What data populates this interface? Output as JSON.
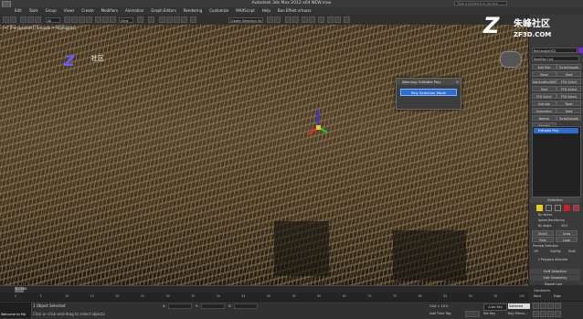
{
  "window": {
    "title": "Autodesk 3ds Max  2012 x64    NEW.max",
    "search_placeholder": "Type a keyword or phrase"
  },
  "menu": [
    "Edit",
    "Tools",
    "Group",
    "Views",
    "Create",
    "Modifiers",
    "Animation",
    "Graph Editors",
    "Rendering",
    "Customize",
    "MAXScript",
    "Help",
    "Bon Effekt vrtuoss"
  ],
  "toolbar": {
    "selection_filter": "All",
    "reference_coord": "View",
    "named_selection": "Create Selection Se"
  },
  "viewport": {
    "label": "[+] [Perspective] [Smooth + Highlights]"
  },
  "watermark": {
    "logo": "Z",
    "text": "社区"
  },
  "brand": {
    "logo": "Z",
    "name": "朱峰社区",
    "url": "ZF3D.COM"
  },
  "dialog": {
    "title": "Warning: Editable Poly",
    "button": "Poly Selection Mode"
  },
  "command_panel": {
    "object_name": "Rectangle002",
    "modifier_list": "Modifier List",
    "buttons": [
      [
        "Edit Poly",
        "TurboSmooth"
      ],
      [
        "Bend",
        "Shell"
      ],
      [
        "HairAndFur(WSM)",
        "FFD 3x3x3"
      ],
      [
        "Shell",
        "FFD 4x4x4"
      ],
      [
        "FFD 2x2x2",
        "FFD Select"
      ],
      [
        "Extrude",
        "Taper"
      ],
      [
        "Symmetry",
        "Shell"
      ],
      [
        "Normal",
        "TurboSmooth"
      ],
      [
        "Smooth",
        ""
      ]
    ],
    "stack_item": "Editable Poly",
    "selection_rollout": "Selection",
    "by_vertex": "By Vertex",
    "ignore_backfacing": "Ignore Backfacing",
    "by_angle": "By Angle:",
    "by_angle_value": "45.0",
    "shrink": "Shrink",
    "grow": "Grow",
    "ring": "Ring",
    "loop": "Loop",
    "preview_selection": "Preview Selection",
    "preview_options": [
      "Off",
      "SubObj",
      "Multi"
    ],
    "selected_count": "2 Polygons Selected",
    "soft_selection": "Soft Selection",
    "edit_geometry": "Edit Geometry",
    "repeat_last": "Repeat Last",
    "constraints": "Constraints",
    "constraint_options": [
      "None",
      "Edge"
    ]
  },
  "timeline": {
    "frame": "0 / 100",
    "ticks": [
      "0",
      "5",
      "10",
      "15",
      "20",
      "25",
      "30",
      "35",
      "40",
      "45",
      "50",
      "55",
      "60",
      "65",
      "70",
      "75",
      "80",
      "85",
      "90",
      "95",
      "100"
    ]
  },
  "status": {
    "maxscript_label": "Welcome to MA",
    "line1": "1 Object Selected",
    "line2": "Click or click-and-drag to select objects",
    "x_label": "X:",
    "y_label": "Y:",
    "z_label": "Z:",
    "grid": "Grid = 10.0",
    "auto_key": "Auto Key",
    "set_key": "Set Key",
    "selected": "Selected",
    "key_filters": "Key Filters...",
    "add_time_tag": "Add Time Tag"
  }
}
